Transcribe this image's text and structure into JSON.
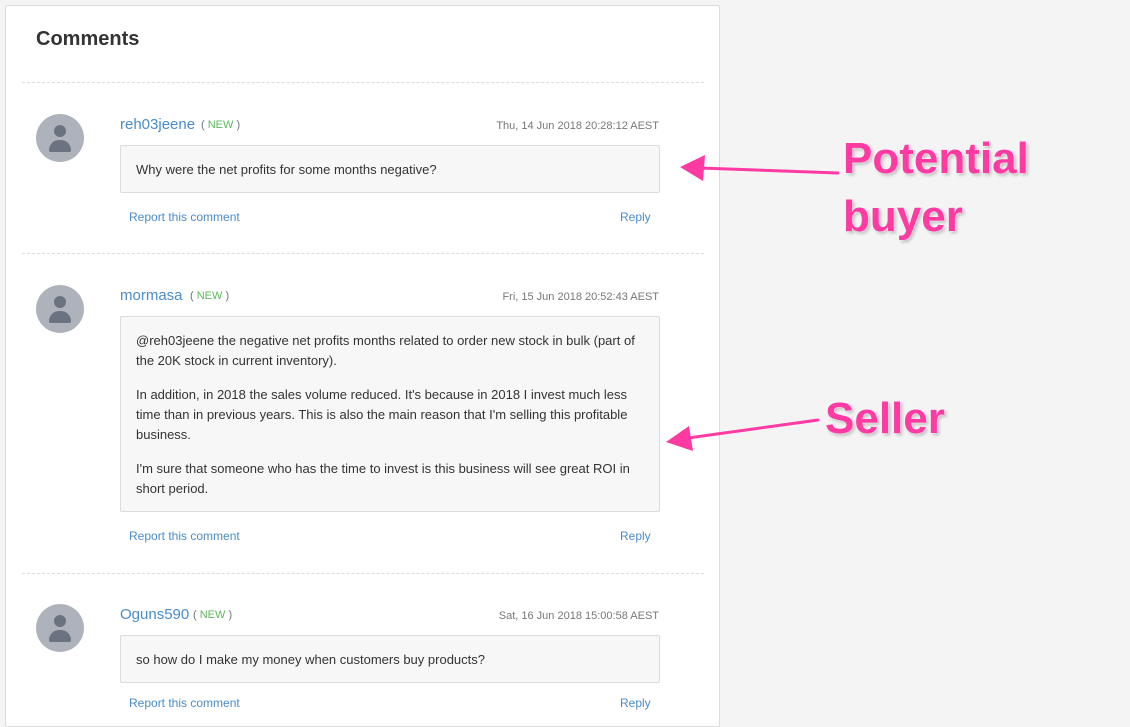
{
  "panel": {
    "title": "Comments"
  },
  "comments": [
    {
      "username": "reh03jeene",
      "badge_open": "(",
      "badge_new": "NEW",
      "badge_close": ")",
      "timestamp": "Thu, 14 Jun 2018 20:28:12 AEST",
      "paragraphs": [
        "Why were the net profits for some months negative?"
      ],
      "report_label": "Report this comment",
      "reply_label": "Reply"
    },
    {
      "username": "mormasa",
      "badge_open": "(",
      "badge_new": "NEW",
      "badge_close": ")",
      "timestamp": "Fri, 15 Jun 2018 20:52:43 AEST",
      "paragraphs": [
        "@reh03jeene the negative net profits months related to order new stock in bulk (part of the 20K stock in current inventory).",
        "In addition, in 2018 the sales volume reduced. It's because in 2018 I invest much less time than in previous years. This is also the main reason that I'm selling this profitable business.",
        "I'm sure that someone who has the time to invest is this business will see great ROI in short period."
      ],
      "report_label": "Report this comment",
      "reply_label": "Reply"
    },
    {
      "username": "Oguns590",
      "badge_open": "(",
      "badge_new": "NEW",
      "badge_close": ")",
      "timestamp": "Sat, 16 Jun 2018 15:00:58 AEST",
      "paragraphs": [
        "so how do I make my money when customers buy products?"
      ],
      "report_label": "Report this comment",
      "reply_label": "Reply"
    }
  ],
  "annotations": {
    "buyer_line1": "Potential",
    "buyer_line2": "buyer",
    "seller": "Seller",
    "color": "#ff3aa3"
  },
  "icons": {
    "avatar": "user-silhouette-icon"
  }
}
